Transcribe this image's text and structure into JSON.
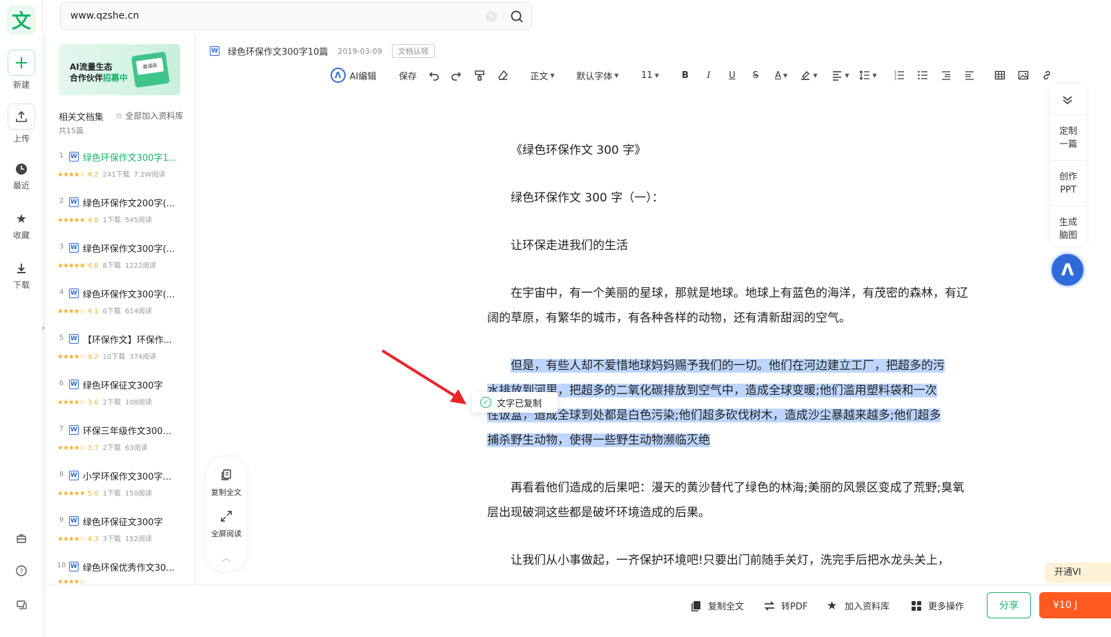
{
  "search": {
    "value": "www.qzshe.cn"
  },
  "rail": {
    "logo": "文",
    "items": [
      {
        "label": "新建",
        "icon": "plus-icon"
      },
      {
        "label": "上传",
        "icon": "upload-icon"
      },
      {
        "label": "最近",
        "icon": "clock-icon"
      },
      {
        "label": "收藏",
        "icon": "star-icon"
      },
      {
        "label": "下载",
        "icon": "download-icon"
      }
    ]
  },
  "side": {
    "banner": {
      "line1": "AI流量生态",
      "line2a": "合作伙伴",
      "line2b": "招募中",
      "card": "邀请函"
    },
    "section_title": "相关文档集",
    "add_all": "全部加入资料库",
    "count": "共15篇",
    "docs": [
      {
        "n": "1",
        "title": "绿色环保作文300字1...",
        "stars": "★★★★☆",
        "rating": "4.2",
        "downloads": "241下载",
        "reads": "7.2W阅读"
      },
      {
        "n": "2",
        "title": "绿色环保作文200字(...",
        "stars": "★★★★★",
        "rating": "4.8",
        "downloads": "1下载",
        "reads": "545阅读"
      },
      {
        "n": "3",
        "title": "绿色环保作文300字(...",
        "stars": "★★★★★",
        "rating": "4.8",
        "downloads": "8下载",
        "reads": "1222阅读"
      },
      {
        "n": "4",
        "title": "绿色环保作文300字(...",
        "stars": "★★★★☆",
        "rating": "4.1",
        "downloads": "6下载",
        "reads": "614阅读"
      },
      {
        "n": "5",
        "title": "【环保作文】环保作...",
        "stars": "★★★★☆",
        "rating": "4.2",
        "downloads": "10下载",
        "reads": "374阅读"
      },
      {
        "n": "6",
        "title": "绿色环保征文300字",
        "stars": "★★★★☆",
        "rating": "3.6",
        "downloads": "2下载",
        "reads": "108阅读"
      },
      {
        "n": "7",
        "title": "环保三年级作文300...",
        "stars": "★★★★☆",
        "rating": "3.7",
        "downloads": "2下载",
        "reads": "63阅读"
      },
      {
        "n": "8",
        "title": "小学环保作文300字...",
        "stars": "★★★★★",
        "rating": "5.0",
        "downloads": "1下载",
        "reads": "150阅读"
      },
      {
        "n": "9",
        "title": "绿色环保征文300字",
        "stars": "★★★★☆",
        "rating": "4.3",
        "downloads": "3下载",
        "reads": "152阅读"
      },
      {
        "n": "10",
        "title": "绿色环保优秀作文30...",
        "stars": "★★★★☆",
        "rating": "",
        "downloads": "",
        "reads": ""
      }
    ]
  },
  "doc": {
    "name": "绿色环保作文300字10篇",
    "date": "2019-03-09",
    "badge": "文档认领"
  },
  "toolbar": {
    "ai_edit": "AI编辑",
    "save": "保存",
    "style": "正文",
    "font": "默认字体",
    "size": "11",
    "bold": "B",
    "italic": "I",
    "underline": "U",
    "strike": "S",
    "fontcolor": "A"
  },
  "right": {
    "custom": "定制\n一篇",
    "ppt": "创作\nPPT",
    "mind": "生成\n脑图"
  },
  "content": {
    "p1": "《绿色环保作文 300 字》",
    "p2": "绿色环保作文 300 字（一）：",
    "p3": "让环保走进我们的生活",
    "p4": "在宇宙中，有一个美丽的星球，那就是地球。地球上有蓝色的海洋，有茂密的森林，有辽阔的草原，有繁华的城市，有各种各样的动物，还有清新甜润的空气。",
    "p5a": "但是，有些人却不爱惜地球妈妈赐予我们的一切。他们在河边建立工厂，把超多的污",
    "p5b": "水排放到河里，把超多的二氧化碳排放到空气中，造成全球变暖;他们滥用塑料袋和一次",
    "p5c": "性饭盒，造成全球到处都是白色污染;他们超多砍伐树木，造成沙尘暴越来越多;他们超多",
    "p5d": "捕杀野生动物，使得一些野生动物濒临灭绝",
    "p6": "再看看他们造成的后果吧：漫天的黄沙替代了绿色的林海;美丽的风景区变成了荒野;臭氧层出现破洞这些都是破坏环境造成的后果。",
    "p7": "让我们从小事做起，一齐保护环境吧!只要出门前随手关灯，洗完手后把水龙头关上，"
  },
  "toast": "文字已复制",
  "float": {
    "copy_all": "复制全文",
    "fullscreen": "全屏阅读"
  },
  "bottom": {
    "copy_all": "复制全文",
    "to_pdf": "转PDF",
    "add_lib": "加入资料库",
    "more": "更多操作",
    "share": "分享",
    "pay": "¥10 J",
    "vip": "开通VI"
  }
}
